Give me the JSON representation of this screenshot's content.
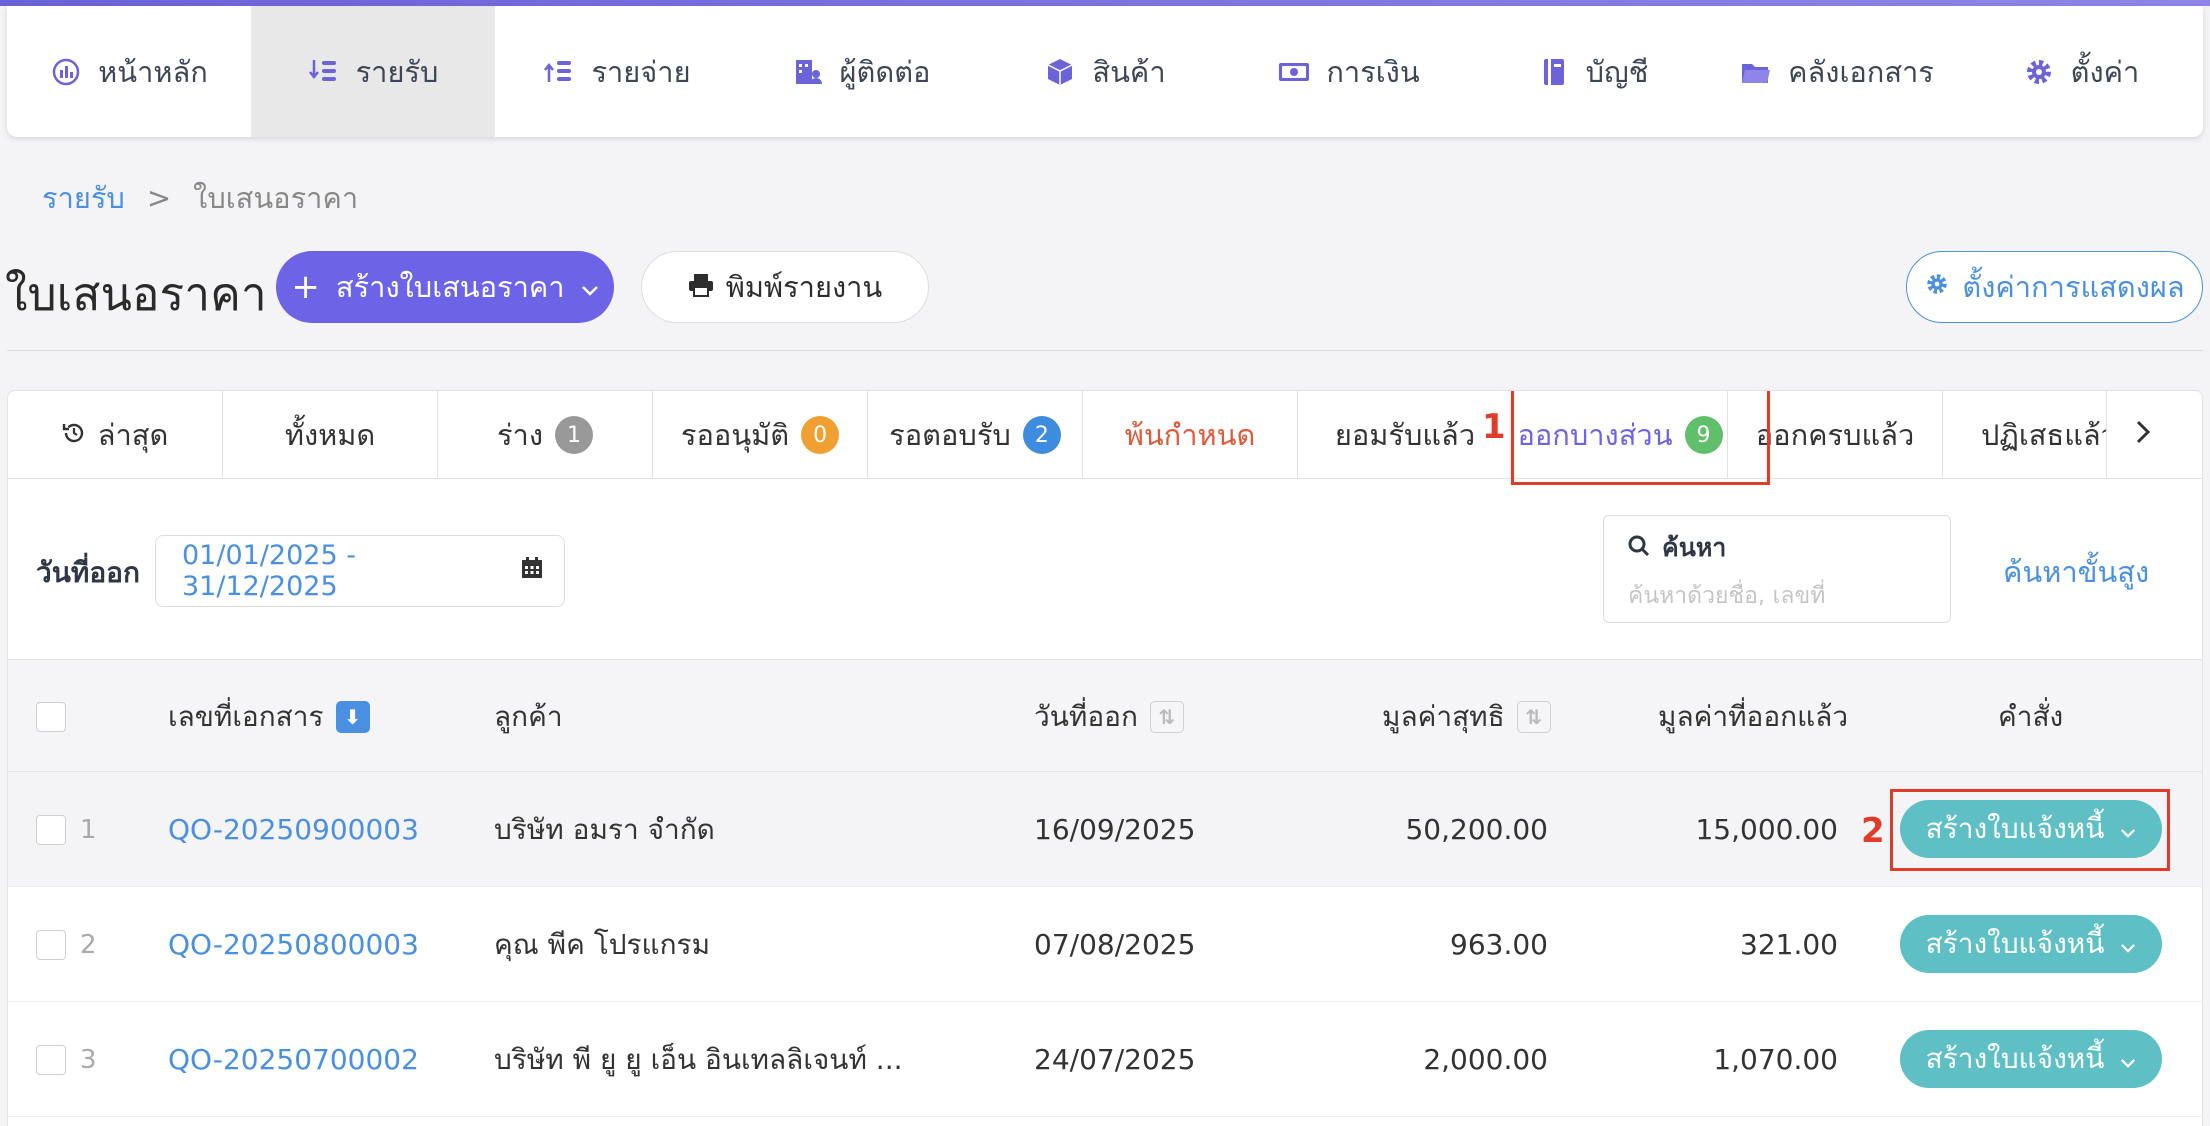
{
  "nav": {
    "items": [
      {
        "label": "หน้าหลัก",
        "icon": "dashboard-icon"
      },
      {
        "label": "รายรับ",
        "icon": "income-icon",
        "active": true
      },
      {
        "label": "รายจ่าย",
        "icon": "expense-icon"
      },
      {
        "label": "ผู้ติดต่อ",
        "icon": "contacts-icon"
      },
      {
        "label": "สินค้า",
        "icon": "box-icon"
      },
      {
        "label": "การเงิน",
        "icon": "money-icon"
      },
      {
        "label": "บัญชี",
        "icon": "ledger-icon"
      },
      {
        "label": "คลังเอกสาร",
        "icon": "folder-icon"
      },
      {
        "label": "ตั้งค่า",
        "icon": "gear-icon"
      }
    ]
  },
  "breadcrumb": {
    "parent": "รายรับ",
    "separator": ">",
    "current": "ใบเสนอราคา"
  },
  "page": {
    "title": "ใบเสนอราคา",
    "create_button": "สร้างใบเสนอราคา",
    "print_button": "พิมพ์รายงาน",
    "settings_button": "ตั้งค่าการแสดงผล"
  },
  "tabs": [
    {
      "label": "ล่าสุด",
      "icon": "history-icon"
    },
    {
      "label": "ทั้งหมด"
    },
    {
      "label": "ร่าง",
      "badge": "1",
      "badge_color": "#999999"
    },
    {
      "label": "รออนุมัติ",
      "badge": "0",
      "badge_color": "#f0a030"
    },
    {
      "label": "รอตอบรับ",
      "badge": "2",
      "badge_color": "#3d8ce0"
    },
    {
      "label": "พ้นกำหนด",
      "color": "#e05a3a"
    },
    {
      "label": "ยอมรับแล้ว"
    },
    {
      "label": "ออกบางส่วน",
      "badge": "9",
      "badge_color": "#5fbf6a",
      "active": true
    },
    {
      "label": "ออกครบแล้ว"
    },
    {
      "label": "ปฏิเสธแล้ว"
    }
  ],
  "annotations": {
    "tab_marker": "1",
    "button_marker": "2",
    "color": "#e03c2a"
  },
  "filter": {
    "date_label": "วันที่ออก",
    "date_range": "01/01/2025 - 31/12/2025",
    "search_title": "ค้นหา",
    "search_placeholder": "ค้นหาด้วยชื่อ, เลขที่",
    "advanced_search": "ค้นหาขั้นสูง"
  },
  "table": {
    "columns": {
      "doc_no": "เลขที่เอกสาร",
      "customer": "ลูกค้า",
      "date": "วันที่ออก",
      "net_value": "มูลค่าสุทธิ",
      "issued_value": "มูลค่าที่ออกแล้ว",
      "action": "คำสั่ง"
    },
    "rows": [
      {
        "num": "1",
        "doc_no": "QO-20250900003",
        "customer": "บริษัท อมรา จำกัด",
        "date": "16/09/2025",
        "net_value": "50,200.00",
        "issued_value": "15,000.00",
        "action": "สร้างใบแจ้งหนี้"
      },
      {
        "num": "2",
        "doc_no": "QO-20250800003",
        "customer": "คุณ พีค โปรแกรม",
        "date": "07/08/2025",
        "net_value": "963.00",
        "issued_value": "321.00",
        "action": "สร้างใบแจ้งหนี้"
      },
      {
        "num": "3",
        "doc_no": "QO-20250700002",
        "customer": "บริษัท พี ยู ยู เอ็น อินเทลลิเจนท์ ...",
        "date": "24/07/2025",
        "net_value": "2,000.00",
        "issued_value": "1,070.00",
        "action": "สร้างใบแจ้งหนี้"
      }
    ]
  },
  "colors": {
    "primary": "#6c63e6",
    "link": "#4a90e2",
    "action": "#5ebfc4",
    "overdue": "#e05a3a"
  }
}
